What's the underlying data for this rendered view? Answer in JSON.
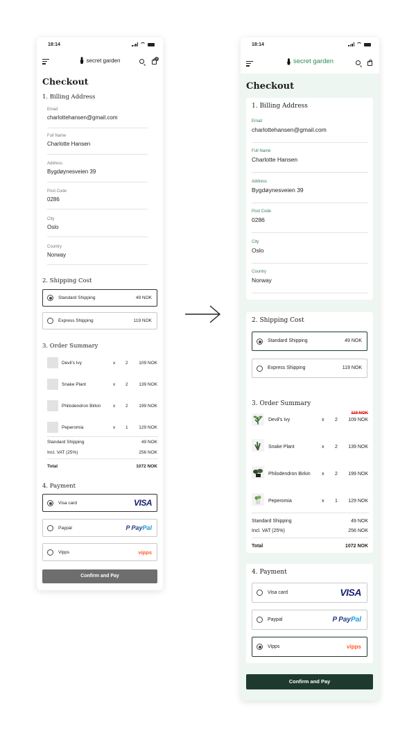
{
  "status_time": "18:14",
  "brand": "secret garden",
  "cart_count": "4",
  "page_title": "Checkout",
  "billing": {
    "title": "1. Billing Address",
    "fields": [
      {
        "label": "Email",
        "value": "charlottehansen@gmail.com"
      },
      {
        "label": "Full Name",
        "value": "Charlotte Hansen"
      },
      {
        "label": "Address",
        "value": "Bygdøynesveien 39"
      },
      {
        "label": "Post Code",
        "value": "0286"
      },
      {
        "label": "City",
        "value": "Oslo"
      },
      {
        "label": "Country",
        "value": "Norway"
      }
    ]
  },
  "shipping": {
    "title": "2. Shipping Cost",
    "options": [
      {
        "label": "Standard Shipping",
        "price": "49 NOK"
      },
      {
        "label": "Express Shipping",
        "price": "119 NOK"
      }
    ]
  },
  "order": {
    "title": "3. Order Summary",
    "original_price": "119 NOK",
    "times": "x",
    "items": [
      {
        "name": "Devil's Ivy",
        "qty": "2",
        "price": "109 NOK"
      },
      {
        "name": "Snake Plant",
        "qty": "2",
        "price": "139 NOK"
      },
      {
        "name": "Philodendron Birkin",
        "qty": "2",
        "price": "199 NOK"
      },
      {
        "name": "Peperomia",
        "qty": "1",
        "price": "129 NOK"
      }
    ],
    "shipping_label": "Standard Shipping",
    "shipping_value": "49 NOK",
    "vat_label": "Incl. VAT (25%)",
    "vat_value": "256 NOK",
    "total_label": "Total",
    "total_value": "1072 NOK"
  },
  "payment": {
    "title": "4. Payment",
    "options": [
      {
        "label": "Visa card",
        "logo": "VISA"
      },
      {
        "label": "Paypal",
        "logo_a": "Pay",
        "logo_b": "Pal",
        "logo_icon": "P"
      },
      {
        "label": "Vipps",
        "logo": "vipps"
      }
    ]
  },
  "confirm_label": "Confirm and Pay",
  "colors": {
    "left_button": "#6e6e6e",
    "right_button": "#1e3a2e",
    "right_background": "#eef6f1",
    "accent_green": "#2e8b57"
  }
}
